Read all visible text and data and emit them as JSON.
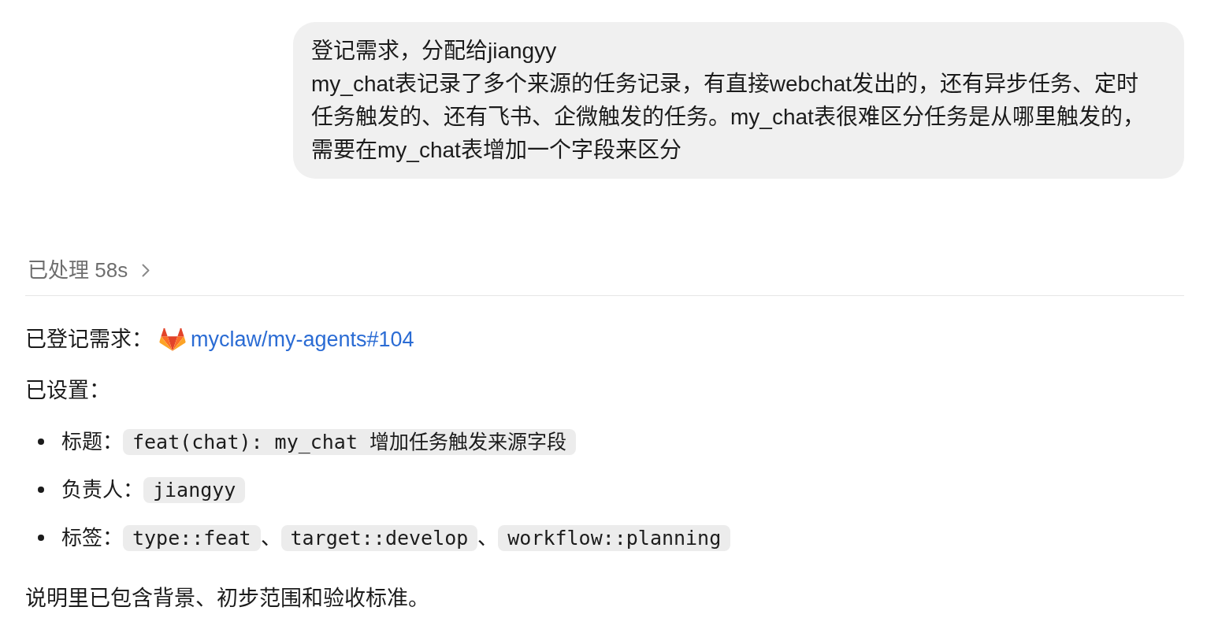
{
  "user_message": {
    "paragraphs": [
      "登记需求，分配给jiangyy",
      "my_chat表记录了多个来源的任务记录，有直接webchat发出的，还有异步任务、定时任务触发的、还有飞书、企微触发的任务。my_chat表很难区分任务是从哪里触发的，需要在my_chat表增加一个字段来区分"
    ]
  },
  "assistant": {
    "processed": {
      "label": "已处理 58s",
      "expanded": false
    },
    "registered": {
      "label": "已登记需求：",
      "link": "myclaw/my-agents#104"
    },
    "settings_heading": "已设置：",
    "settings": [
      {
        "label": "标题：",
        "values": [
          {
            "kind": "code",
            "text": "feat(chat): my_chat 增加任务触发来源字段"
          }
        ]
      },
      {
        "label": "负责人：",
        "values": [
          {
            "kind": "code",
            "text": "jiangyy"
          }
        ]
      },
      {
        "label": "标签：",
        "values": [
          {
            "kind": "code",
            "text": "type::feat"
          },
          {
            "kind": "text",
            "text": "、"
          },
          {
            "kind": "code",
            "text": "target::develop"
          },
          {
            "kind": "text",
            "text": "、"
          },
          {
            "kind": "code",
            "text": "workflow::planning"
          }
        ]
      }
    ],
    "summary": "说明里已包含背景、初步范围和验收标准。"
  }
}
